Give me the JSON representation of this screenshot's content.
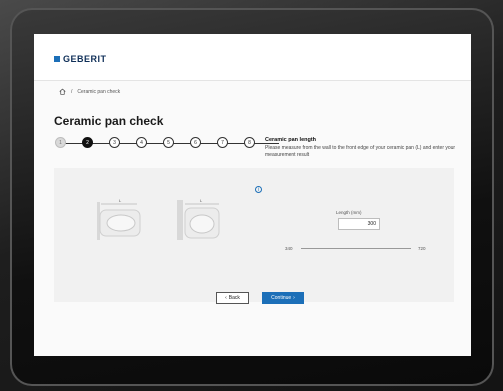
{
  "brand": {
    "name": "GEBERIT",
    "color": "#1c6fb8"
  },
  "breadcrumb": {
    "home_icon": "home-icon",
    "current": "Ceramic pan check"
  },
  "page": {
    "title": "Ceramic pan check"
  },
  "stepper": {
    "steps": [
      "1",
      "2",
      "3",
      "4",
      "5",
      "6",
      "7",
      "8"
    ],
    "current_step": 2,
    "heading": "Ceramic pan length",
    "description": "Please measure from the wall to the front edge of your ceramic pan (L) and enter your measurement result"
  },
  "measurement": {
    "label": "Length (mm)",
    "value": "300",
    "slider_min": "340",
    "slider_max": "720"
  },
  "images": {
    "label_top": "L"
  },
  "actions": {
    "back": "Back",
    "back_icon": "chevron-left-icon",
    "continue": "Continue",
    "continue_icon": "chevron-right-icon"
  }
}
